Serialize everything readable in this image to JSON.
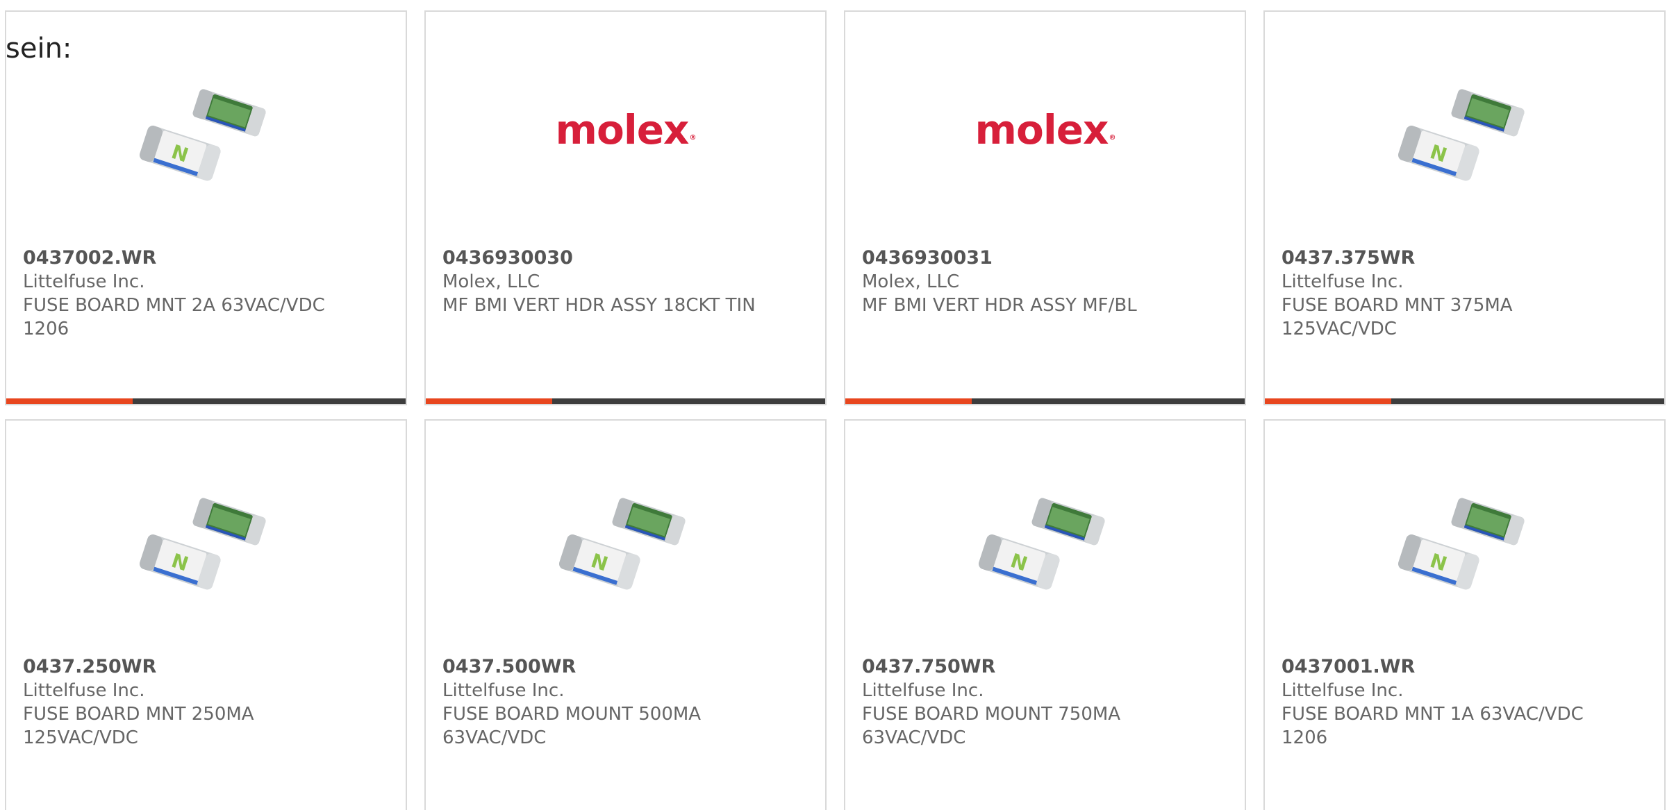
{
  "intro_text": "sein:",
  "colors": {
    "accent": "#e8461e",
    "bar": "#3d3d3d",
    "brand_molex": "#d71f3a",
    "border": "#d9d9d9"
  },
  "products": [
    {
      "part_number": "0437002.WR",
      "manufacturer": "Littelfuse Inc.",
      "description": "FUSE BOARD MNT 2A 63VAC/VDC 1206",
      "image": "smd-fuse-photo",
      "has_bar": true
    },
    {
      "part_number": "0436930030",
      "manufacturer": "Molex, LLC",
      "description": "MF BMI VERT HDR ASSY 18CKT TIN",
      "image": "molex-logo",
      "has_bar": true
    },
    {
      "part_number": "0436930031",
      "manufacturer": "Molex, LLC",
      "description": "MF BMI VERT HDR ASSY MF/BL",
      "image": "molex-logo",
      "has_bar": true
    },
    {
      "part_number": "0437.375WR",
      "manufacturer": "Littelfuse Inc.",
      "description": "FUSE BOARD MNT 375MA 125VAC/VDC",
      "image": "smd-fuse-photo",
      "has_bar": true
    },
    {
      "part_number": "0437.250WR",
      "manufacturer": "Littelfuse Inc.",
      "description": "FUSE BOARD MNT 250MA 125VAC/VDC",
      "image": "smd-fuse-photo",
      "has_bar": false
    },
    {
      "part_number": "0437.500WR",
      "manufacturer": "Littelfuse Inc.",
      "description": "FUSE BOARD MOUNT 500MA 63VAC/VDC",
      "image": "smd-fuse-photo",
      "has_bar": false
    },
    {
      "part_number": "0437.750WR",
      "manufacturer": "Littelfuse Inc.",
      "description": "FUSE BOARD MOUNT 750MA 63VAC/VDC",
      "image": "smd-fuse-photo",
      "has_bar": false
    },
    {
      "part_number": "0437001.WR",
      "manufacturer": "Littelfuse Inc.",
      "description": "FUSE BOARD MNT 1A 63VAC/VDC 1206",
      "image": "smd-fuse-photo",
      "has_bar": false
    }
  ],
  "logo": {
    "text": "molex",
    "mark": "®"
  }
}
